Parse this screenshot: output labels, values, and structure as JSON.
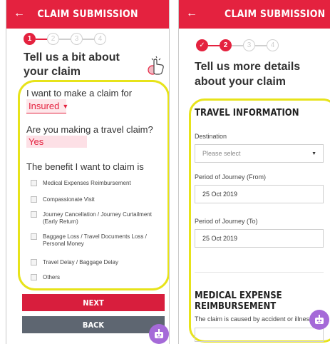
{
  "left_screen": {
    "header_title": "CLAIM SUBMISSION",
    "back_arrow": "←",
    "steps": [
      "1",
      "2",
      "3",
      "4"
    ],
    "heading": "Tell us a bit about your claim",
    "question_claim_for": "I want to make a claim for",
    "claim_for_value": "Insured",
    "question_travel": "Are you making a travel claim?",
    "travel_value": "Yes",
    "question_benefit": "The benefit I want to claim is",
    "benefits": [
      "Medical Expenses Reimbursement",
      "Compassionate Visit",
      "Journey Cancellation / Journey Curtailment (Early Return)",
      "Baggage Loss / Travel Documents Loss / Personal Money",
      "Travel Delay / Baggage Delay",
      "Others"
    ],
    "next_label": "NEXT",
    "back_label": "BACK"
  },
  "right_screen": {
    "header_title": "CLAIM SUBMISSION",
    "back_arrow": "←",
    "steps": [
      "✓",
      "2",
      "3",
      "4"
    ],
    "heading": "Tell us more details about your claim",
    "section_travel": "TRAVEL INFORMATION",
    "destination_label": "Destination",
    "destination_placeholder": "Please select",
    "from_label": "Period of Journey (From)",
    "from_value": "25 Oct 2019",
    "to_label": "Period of Journey (To)",
    "to_value": "25 Oct 2019",
    "section_medical": "MEDICAL EXPENSE REIMBURSEMENT",
    "cause_label": "The claim is caused by accident or illness"
  },
  "colors": {
    "brand_red": "#e4223f",
    "highlight_yellow": "#e7e31a",
    "back_button_gray": "#5e6671",
    "chatbot_purple": "#a56ad8"
  },
  "icons": [
    "back-arrow-icon",
    "hand-tap-icon",
    "chevron-down-icon",
    "caret-down-icon",
    "chatbot-icon",
    "checkmark-icon"
  ]
}
